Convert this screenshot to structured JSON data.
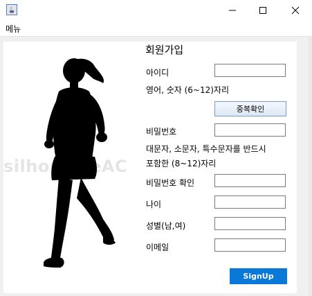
{
  "window": {
    "icons": {
      "app": "java-app-icon",
      "minimize": "minimize-icon",
      "maximize": "maximize-icon",
      "close": "close-icon"
    }
  },
  "menu": {
    "item": "메뉴"
  },
  "form": {
    "title": "회원가입",
    "id_label": "아이디",
    "id_hint": "영어, 숫자 (6~12)자리",
    "duplicate_check": "중복확인",
    "password_label": "비밀번호",
    "password_hint_1": "대문자, 소문자, 특수문자를 반드시",
    "password_hint_2": "포함한 (8~12)자리",
    "password_confirm_label": "비밀번호 확인",
    "age_label": "나이",
    "gender_label": "성별(남,여)",
    "email_label": "이메일",
    "signup": "SignUp",
    "values": {
      "id": "",
      "password": "",
      "password_confirm": "",
      "age": "",
      "gender": "",
      "email": ""
    }
  },
  "image": {
    "subject": "runner-silhouette",
    "watermark": "silhouetteAC"
  },
  "colors": {
    "accent": "#0a78d7",
    "silhouette": "#000000",
    "background": "#f0f0f0"
  }
}
